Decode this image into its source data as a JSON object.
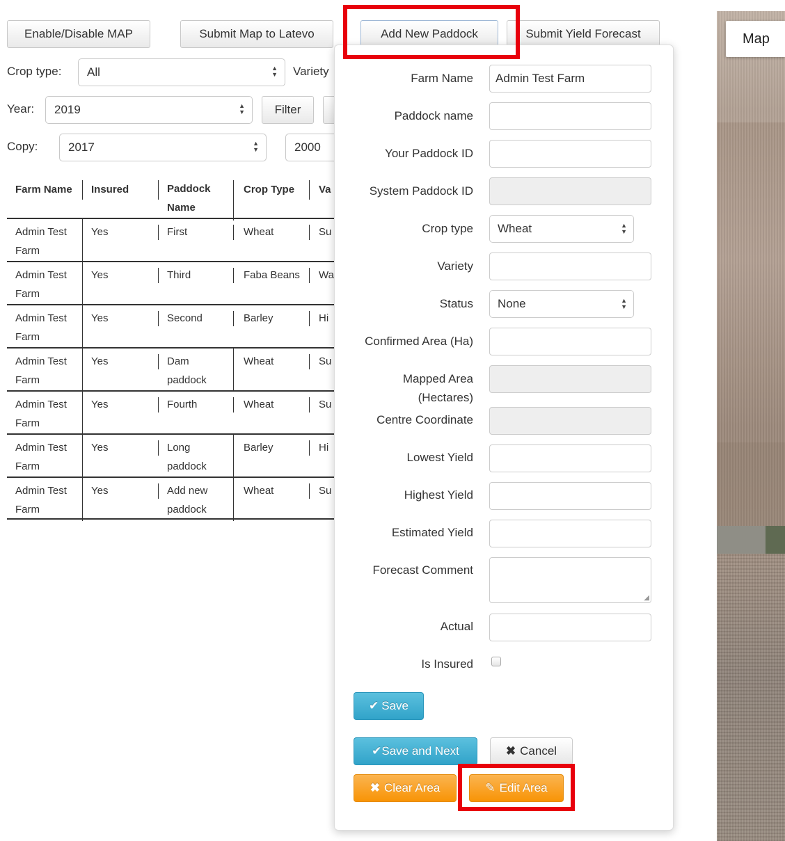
{
  "toolbar": {
    "enable_map": "Enable/Disable MAP",
    "submit_map": "Submit Map to Latevo",
    "add_paddock": "Add New Paddock",
    "submit_forecast": "Submit Yield Forecast"
  },
  "filters": {
    "crop_type_label": "Crop type:",
    "crop_type_value": "All",
    "variety_label": "Variety",
    "year_label": "Year:",
    "year_value": "2019",
    "filter_button": "Filter",
    "copy_label": "Copy:",
    "copy_value": "2017",
    "copy_to_value": "2000"
  },
  "table": {
    "headers": {
      "farm_name": "Farm Name",
      "insured": "Insured",
      "paddock_l1": "Paddock",
      "paddock_l2": "Name",
      "crop_type": "Crop Type",
      "variety": "Va"
    },
    "rows": [
      {
        "farm_l1": "Admin Test",
        "farm_l2": "Farm",
        "insured": "Yes",
        "pad_l1": "First",
        "pad_l2": "",
        "crop": "Wheat",
        "variety": "Su"
      },
      {
        "farm_l1": "Admin Test",
        "farm_l2": "Farm",
        "insured": "Yes",
        "pad_l1": "Third",
        "pad_l2": "",
        "crop": "Faba Beans",
        "variety": "Wa"
      },
      {
        "farm_l1": "Admin Test",
        "farm_l2": "Farm",
        "insured": "Yes",
        "pad_l1": "Second",
        "pad_l2": "",
        "crop": "Barley",
        "variety": "Hi"
      },
      {
        "farm_l1": "Admin Test",
        "farm_l2": "Farm",
        "insured": "Yes",
        "pad_l1": "Dam",
        "pad_l2": "paddock",
        "crop": "Wheat",
        "variety": "Su"
      },
      {
        "farm_l1": "Admin Test",
        "farm_l2": "Farm",
        "insured": "Yes",
        "pad_l1": "Fourth",
        "pad_l2": "",
        "crop": "Wheat",
        "variety": "Su"
      },
      {
        "farm_l1": "Admin Test",
        "farm_l2": "Farm",
        "insured": "Yes",
        "pad_l1": "Long",
        "pad_l2": "paddock",
        "crop": "Barley",
        "variety": "Hi"
      },
      {
        "farm_l1": "Admin Test",
        "farm_l2": "Farm",
        "insured": "Yes",
        "pad_l1": "Add new",
        "pad_l2": "paddock",
        "crop": "Wheat",
        "variety": "Su"
      }
    ]
  },
  "form": {
    "farm_name_label": "Farm Name",
    "farm_name_value": "Admin Test Farm",
    "paddock_name_label": "Paddock name",
    "your_id_label": "Your Paddock ID",
    "system_id_label": "System Paddock ID",
    "crop_type_label": "Crop type",
    "crop_type_value": "Wheat",
    "variety_label": "Variety",
    "status_label": "Status",
    "status_value": "None",
    "confirmed_area_label": "Confirmed Area (Ha)",
    "mapped_area_l1": "Mapped Area",
    "mapped_area_l2": "(Hectares)",
    "centre_label": "Centre Coordinate",
    "lowest_label": "Lowest Yield",
    "highest_label": "Highest Yield",
    "estimated_label": "Estimated Yield",
    "comment_label": "Forecast Comment",
    "actual_label": "Actual",
    "insured_label": "Is Insured",
    "save": "Save",
    "save_next": "Save and Next",
    "cancel": "Cancel",
    "clear_area": "Clear Area",
    "edit_area": "Edit Area"
  },
  "map": {
    "tab_label": "Map"
  },
  "colors": {
    "highlight": "#e8000c",
    "info": "#31a3c9",
    "warning": "#f89406"
  }
}
